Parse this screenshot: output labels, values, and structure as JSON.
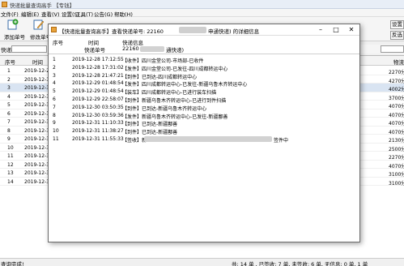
{
  "main_window": {
    "title": "快递批量查询高手 【专钱】",
    "menu": [
      "文件(F)",
      "编辑(E)",
      "查看(V)",
      "设置(S)",
      "工具(T)",
      "公告(G)",
      "帮助(H)"
    ],
    "toolbar": [
      {
        "label": "添加单号",
        "icon": "add-icon"
      },
      {
        "label": "修改单号",
        "icon": "edit-icon"
      }
    ],
    "right_buttons": [
      "设置",
      "反选"
    ],
    "filter_label": "快递:",
    "grid": {
      "headers": [
        "序号",
        "时间",
        "物流"
      ],
      "rows": [
        {
          "no": "1",
          "time": "2019-12-2",
          "tail": "2270分"
        },
        {
          "no": "2",
          "time": "2019-12-3",
          "tail": "4270分"
        },
        {
          "no": "3",
          "time": "2019-12-3",
          "tail": "4002分"
        },
        {
          "no": "4",
          "time": "2019-12-3",
          "tail": "3700分"
        },
        {
          "no": "5",
          "time": "2019-12-3",
          "tail": "4070分"
        },
        {
          "no": "6",
          "time": "2019-12-3",
          "tail": "4070分"
        },
        {
          "no": "7",
          "time": "2019-12-3",
          "tail": "4070分"
        },
        {
          "no": "8",
          "time": "2019-12-3",
          "tail": "4070分"
        },
        {
          "no": "9",
          "time": "2019-12-3",
          "tail": "2130分"
        },
        {
          "no": "10",
          "time": "2019-12-3",
          "tail": "2500分"
        },
        {
          "no": "11",
          "time": "2019-12-3",
          "tail": "2270分"
        },
        {
          "no": "12",
          "time": "2019-12-3",
          "tail": "4070分"
        },
        {
          "no": "13",
          "time": "2019-12-3",
          "tail": "3100分"
        },
        {
          "no": "14",
          "time": "2019-12-3",
          "tail": "3100分"
        }
      ]
    },
    "status": {
      "left": "查询完成!",
      "right": "共: 14 单 , 已签收: 7 单, 未签收: 6 单, 无信息: 0 单, 1 单"
    }
  },
  "dialog": {
    "title_pre": "【快递批量查询高手】查看快递单号: 22160",
    "title_post": "申通快递) 的详细信息",
    "hdr1": {
      "no": "序号",
      "time": "时间",
      "info": "快递信息"
    },
    "hdr2": {
      "label": "快递单号",
      "value_pre": "22160",
      "value_post": "通快递)"
    },
    "rows": [
      {
        "no": "1",
        "time": "2019-12-28 17:12:55",
        "msg": "【收件】四川金堂公司-市场部-已收件"
      },
      {
        "no": "2",
        "time": "2019-12-28 17:31:02",
        "msg": "【发件】四川金堂公司-已发往-四川成都转运中心"
      },
      {
        "no": "3",
        "time": "2019-12-28 21:47:21",
        "msg": "【到件】已到达-四川成都转运中心"
      },
      {
        "no": "4",
        "time": "2019-12-29 01:48:54",
        "msg": "【发件】四川成都转运中心-已发往-新疆乌鲁木齐转运中心"
      },
      {
        "no": "5",
        "time": "2019-12-29 01:48:54",
        "msg": "【装车】四川成都转运中心-已进行装车扫描"
      },
      {
        "no": "6",
        "time": "2019-12-29 22:58:07",
        "msg": "【到件】新疆乌鲁木齐转运中心-已进行到件扫描"
      },
      {
        "no": "7",
        "time": "2019-12-30 03:50:35",
        "msg": "【到件】已到达-新疆乌鲁木齐转运中心"
      },
      {
        "no": "8",
        "time": "2019-12-30 03:59:36",
        "msg": "【发件】新疆乌鲁木齐转运中心-已发往-新疆鄯善"
      },
      {
        "no": "9",
        "time": "2019-12-31 11:10:33",
        "msg": "【到件】已到达-新疆鄯善"
      },
      {
        "no": "10",
        "time": "2019-12-31 11:38:27",
        "msg": "【到件】已到达-新疆鄯善"
      },
      {
        "no": "11",
        "time": "2019-12-31 11:55:33",
        "msg_pre": "【签收】新",
        "msg_post": "签件中"
      }
    ]
  },
  "colors": {
    "dialog_icon": "#e8a33a",
    "selected_row": "#d9e4f2"
  }
}
